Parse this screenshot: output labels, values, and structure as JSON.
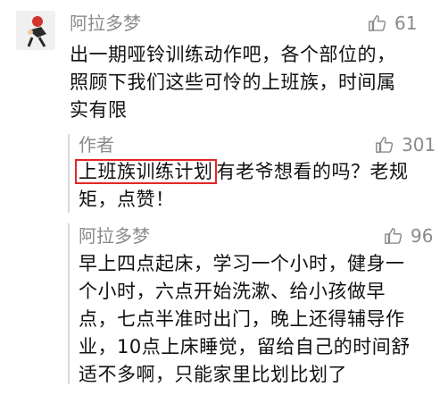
{
  "comment": {
    "author": "阿拉多梦",
    "likes": "61",
    "text_lines": [
      "出一期哑铃训练动作吧，各个部位的，",
      "照顾下我们这些可怜的上班族，时间属",
      "实有限"
    ]
  },
  "reply_author": {
    "author": "作者",
    "likes": "301",
    "highlight": "上班族训练计划",
    "line1_rest": "有老爷想看的吗？老规",
    "line2": "矩，点赞！"
  },
  "reply_user": {
    "author": "阿拉多梦",
    "likes": "96",
    "text_lines": [
      "早上四点起床，学习一个小时，健身一",
      "个小时，六点开始洗漱、给小孩做早",
      "点，七点半准时出门，晚上还得辅导作",
      "业，10点上床睡觉，留给自己的时间舒",
      "适不多啊，只能家里比划比划了"
    ]
  }
}
